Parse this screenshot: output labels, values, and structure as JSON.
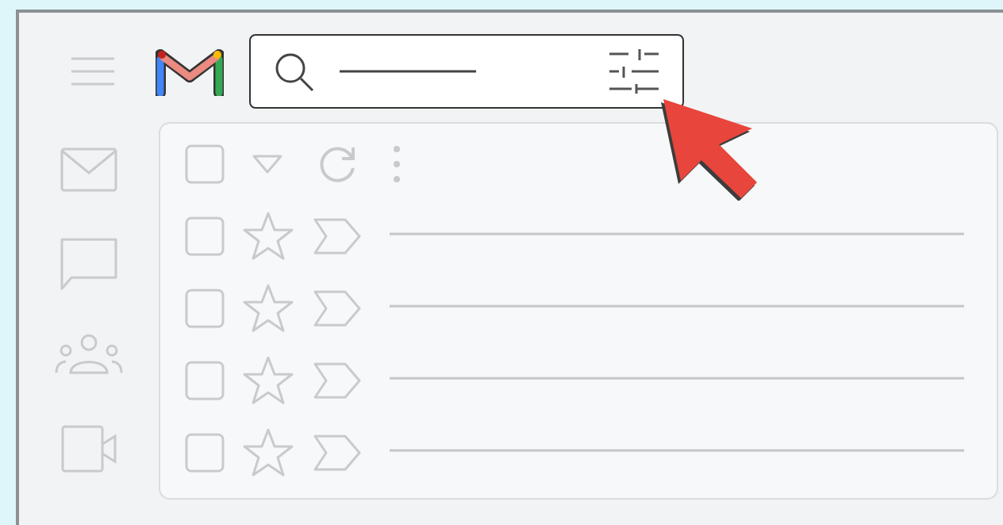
{
  "toolbar": {
    "select_all_checked": false
  },
  "rows": [
    {
      "checked": false,
      "starred": false
    },
    {
      "checked": false,
      "starred": false
    },
    {
      "checked": false,
      "starred": false
    },
    {
      "checked": false,
      "starred": false
    }
  ]
}
